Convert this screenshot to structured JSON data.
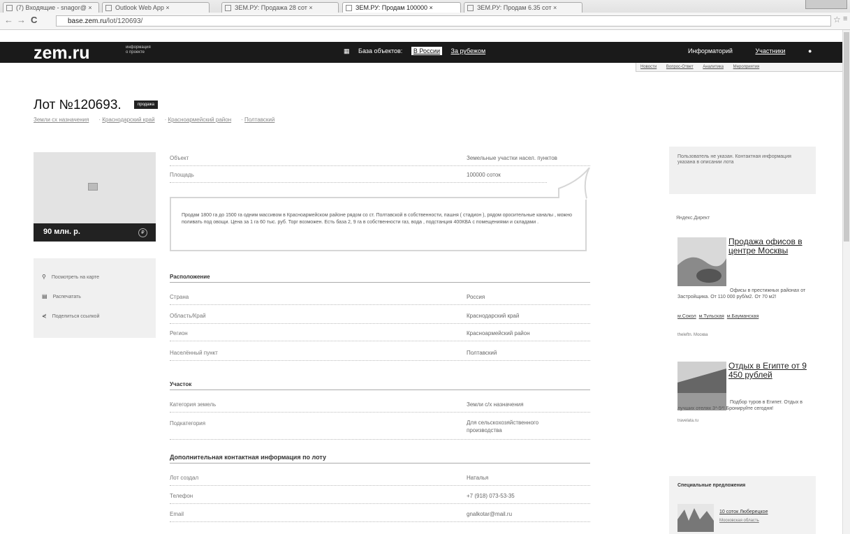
{
  "browser": {
    "tabs": [
      {
        "label": "(7) Входящие - snagor@ ×"
      },
      {
        "label": "Outlook Web App ×"
      },
      {
        "label": "ЗЕМ.РУ: Продажа 28 сот ×"
      },
      {
        "label": "ЗЕМ.РУ: Продам 100000 ×"
      },
      {
        "label": "ЗЕМ.РУ: Продам 6.35 сот ×"
      }
    ],
    "url_domain": "base.zem.ru",
    "url_path": "/lot/120693/"
  },
  "site": {
    "logo": "zem.ru",
    "tagline": [
      "информация",
      "о проекте"
    ],
    "nav": {
      "db": "База объектов:",
      "russia": "В России",
      "abroad": "За рубежом"
    },
    "user": {
      "info": "Информаторий",
      "members": "Участники"
    },
    "submenu": [
      "Новости",
      "Вопрос-Ответ",
      "Аналитика",
      "Мероприятия"
    ]
  },
  "lot": {
    "title": "Лот №120693.",
    "badge": "продажа",
    "breadcrumbs": [
      "Земли сх назначения",
      "Краснодарский край",
      "Красноармейский район",
      "Полтавский"
    ],
    "price": "90 млн. р.",
    "price_icon": "₽",
    "actions": [
      {
        "icon": "pin-icon",
        "glyph": "⚲",
        "label": "Посмотреть на карте"
      },
      {
        "icon": "print-icon",
        "glyph": "▤",
        "label": "Распечатать"
      },
      {
        "icon": "share-icon",
        "glyph": "⋞",
        "label": "Поделиться ссылкой"
      }
    ],
    "object_label": "Объект",
    "object_value": "Земельные участки насел. пунктов",
    "area_label": "Площадь",
    "area_value": "100000 соток",
    "description": "Продам 1800 га до 1500 га одним массивом в Красноармейском районе рядом со ст. Полтавской в собственности, пашня ( стадион ), рядом оросительные каналы , можно поливать под овощи. Цена за 1 га 60 тыс. руб. Торг возможен. Есть база 2, 9 га в собственности газ, вода , подстанция 400КВА с помещениями и складами .",
    "location": {
      "title": "Расположение",
      "rows": [
        {
          "label": "Страна",
          "value": "Россия"
        },
        {
          "label": "Область/Край",
          "value": "Краснодарский край"
        },
        {
          "label": "Регион",
          "value": "Красноармейский район"
        },
        {
          "label": "Населённый пункт",
          "value": "Полтавский"
        }
      ]
    },
    "plot": {
      "title": "Участок",
      "rows": [
        {
          "label": "Категория земель",
          "value": "Земли с/х назначения"
        },
        {
          "label": "Подкатегория",
          "value": "Для сельскохозяйственного производства"
        }
      ]
    },
    "contacts": {
      "title": "Дополнительная контактная информация по лоту",
      "rows": [
        {
          "label": "Лот создал",
          "value": "Наталья"
        },
        {
          "label": "Телефон",
          "value": "+7 (918) 073-53-35"
        },
        {
          "label": "Email",
          "value": "gnalkotar@mail.ru"
        }
      ]
    }
  },
  "sidebar": {
    "contact_note": "Пользователь не указан. Контактная информация указана в описании лота",
    "yandex_label": "Яндекс.Директ",
    "ads": [
      {
        "title": "Продажа офисов в центре Москвы",
        "text": "Офисы в престижных районах от Застройщика. От 110 000 руб/м2. От 70 м2!",
        "links": [
          "м.Сокол",
          "м.Тульская",
          "м.Бауманская"
        ],
        "domain": "theleftn. Москва"
      },
      {
        "title": "Отдых в Египте от 9 450 рублей",
        "text": "Подбор туров в Египет. Отдых в лучших отелях 3*-5*! Бронируйте сегодня!",
        "links": [],
        "domain": "travelata.ru"
      }
    ],
    "special": {
      "title": "Специальные предложения",
      "link": "10 соток Люберецкое",
      "sub": "Московская область"
    }
  }
}
